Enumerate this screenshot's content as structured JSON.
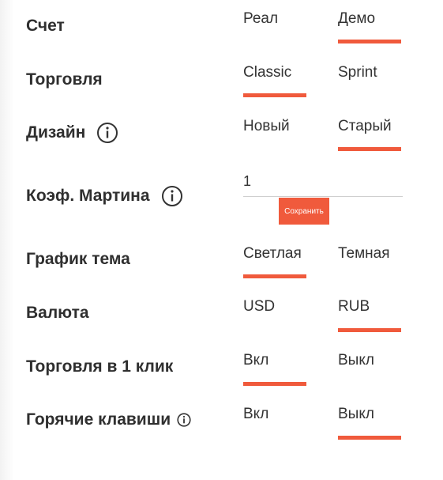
{
  "accent_color": "#f05a3c",
  "settings": {
    "account": {
      "label": "Счет",
      "options": [
        "Реал",
        "Демо"
      ],
      "selected": 1
    },
    "trading": {
      "label": "Торговля",
      "options": [
        "Classic",
        "Sprint"
      ],
      "selected": 0
    },
    "design": {
      "label": "Дизайн",
      "options": [
        "Новый",
        "Старый"
      ],
      "selected": 1
    },
    "martingale": {
      "label": "Коэф. Мартина",
      "value": "1",
      "save_label": "Сохранить"
    },
    "chart_theme": {
      "label": "График тема",
      "options": [
        "Светлая",
        "Темная"
      ],
      "selected": 0
    },
    "currency": {
      "label": "Валюта",
      "options": [
        "USD",
        "RUB"
      ],
      "selected": 1
    },
    "one_click": {
      "label": "Торговля в 1 клик",
      "options": [
        "Вкл",
        "Выкл"
      ],
      "selected": 0
    },
    "hotkeys": {
      "label": "Горячие клавиши",
      "options": [
        "Вкл",
        "Выкл"
      ],
      "selected": 1
    }
  }
}
